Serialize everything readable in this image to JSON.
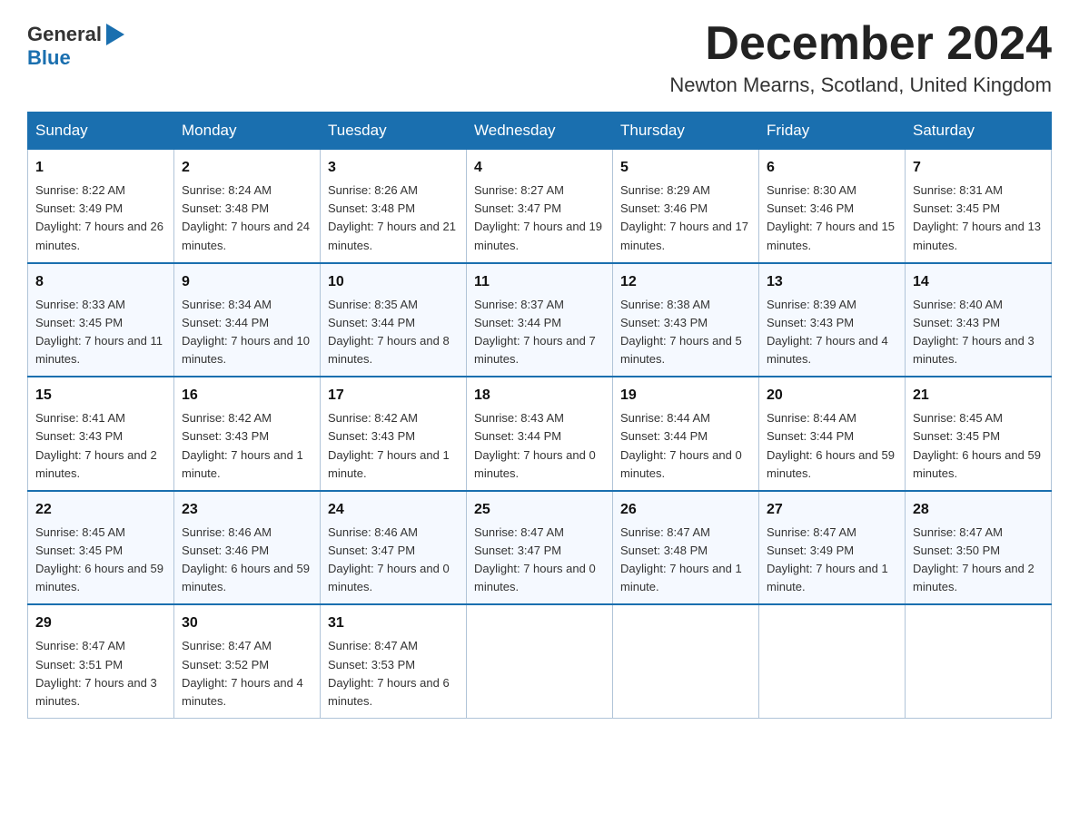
{
  "header": {
    "logo_general": "General",
    "logo_blue": "Blue",
    "month_title": "December 2024",
    "location": "Newton Mearns, Scotland, United Kingdom"
  },
  "weekdays": [
    "Sunday",
    "Monday",
    "Tuesday",
    "Wednesday",
    "Thursday",
    "Friday",
    "Saturday"
  ],
  "weeks": [
    [
      {
        "day": "1",
        "sunrise": "8:22 AM",
        "sunset": "3:49 PM",
        "daylight": "7 hours and 26 minutes."
      },
      {
        "day": "2",
        "sunrise": "8:24 AM",
        "sunset": "3:48 PM",
        "daylight": "7 hours and 24 minutes."
      },
      {
        "day": "3",
        "sunrise": "8:26 AM",
        "sunset": "3:48 PM",
        "daylight": "7 hours and 21 minutes."
      },
      {
        "day": "4",
        "sunrise": "8:27 AM",
        "sunset": "3:47 PM",
        "daylight": "7 hours and 19 minutes."
      },
      {
        "day": "5",
        "sunrise": "8:29 AM",
        "sunset": "3:46 PM",
        "daylight": "7 hours and 17 minutes."
      },
      {
        "day": "6",
        "sunrise": "8:30 AM",
        "sunset": "3:46 PM",
        "daylight": "7 hours and 15 minutes."
      },
      {
        "day": "7",
        "sunrise": "8:31 AM",
        "sunset": "3:45 PM",
        "daylight": "7 hours and 13 minutes."
      }
    ],
    [
      {
        "day": "8",
        "sunrise": "8:33 AM",
        "sunset": "3:45 PM",
        "daylight": "7 hours and 11 minutes."
      },
      {
        "day": "9",
        "sunrise": "8:34 AM",
        "sunset": "3:44 PM",
        "daylight": "7 hours and 10 minutes."
      },
      {
        "day": "10",
        "sunrise": "8:35 AM",
        "sunset": "3:44 PM",
        "daylight": "7 hours and 8 minutes."
      },
      {
        "day": "11",
        "sunrise": "8:37 AM",
        "sunset": "3:44 PM",
        "daylight": "7 hours and 7 minutes."
      },
      {
        "day": "12",
        "sunrise": "8:38 AM",
        "sunset": "3:43 PM",
        "daylight": "7 hours and 5 minutes."
      },
      {
        "day": "13",
        "sunrise": "8:39 AM",
        "sunset": "3:43 PM",
        "daylight": "7 hours and 4 minutes."
      },
      {
        "day": "14",
        "sunrise": "8:40 AM",
        "sunset": "3:43 PM",
        "daylight": "7 hours and 3 minutes."
      }
    ],
    [
      {
        "day": "15",
        "sunrise": "8:41 AM",
        "sunset": "3:43 PM",
        "daylight": "7 hours and 2 minutes."
      },
      {
        "day": "16",
        "sunrise": "8:42 AM",
        "sunset": "3:43 PM",
        "daylight": "7 hours and 1 minute."
      },
      {
        "day": "17",
        "sunrise": "8:42 AM",
        "sunset": "3:43 PM",
        "daylight": "7 hours and 1 minute."
      },
      {
        "day": "18",
        "sunrise": "8:43 AM",
        "sunset": "3:44 PM",
        "daylight": "7 hours and 0 minutes."
      },
      {
        "day": "19",
        "sunrise": "8:44 AM",
        "sunset": "3:44 PM",
        "daylight": "7 hours and 0 minutes."
      },
      {
        "day": "20",
        "sunrise": "8:44 AM",
        "sunset": "3:44 PM",
        "daylight": "6 hours and 59 minutes."
      },
      {
        "day": "21",
        "sunrise": "8:45 AM",
        "sunset": "3:45 PM",
        "daylight": "6 hours and 59 minutes."
      }
    ],
    [
      {
        "day": "22",
        "sunrise": "8:45 AM",
        "sunset": "3:45 PM",
        "daylight": "6 hours and 59 minutes."
      },
      {
        "day": "23",
        "sunrise": "8:46 AM",
        "sunset": "3:46 PM",
        "daylight": "6 hours and 59 minutes."
      },
      {
        "day": "24",
        "sunrise": "8:46 AM",
        "sunset": "3:47 PM",
        "daylight": "7 hours and 0 minutes."
      },
      {
        "day": "25",
        "sunrise": "8:47 AM",
        "sunset": "3:47 PM",
        "daylight": "7 hours and 0 minutes."
      },
      {
        "day": "26",
        "sunrise": "8:47 AM",
        "sunset": "3:48 PM",
        "daylight": "7 hours and 1 minute."
      },
      {
        "day": "27",
        "sunrise": "8:47 AM",
        "sunset": "3:49 PM",
        "daylight": "7 hours and 1 minute."
      },
      {
        "day": "28",
        "sunrise": "8:47 AM",
        "sunset": "3:50 PM",
        "daylight": "7 hours and 2 minutes."
      }
    ],
    [
      {
        "day": "29",
        "sunrise": "8:47 AM",
        "sunset": "3:51 PM",
        "daylight": "7 hours and 3 minutes."
      },
      {
        "day": "30",
        "sunrise": "8:47 AM",
        "sunset": "3:52 PM",
        "daylight": "7 hours and 4 minutes."
      },
      {
        "day": "31",
        "sunrise": "8:47 AM",
        "sunset": "3:53 PM",
        "daylight": "7 hours and 6 minutes."
      },
      null,
      null,
      null,
      null
    ]
  ]
}
